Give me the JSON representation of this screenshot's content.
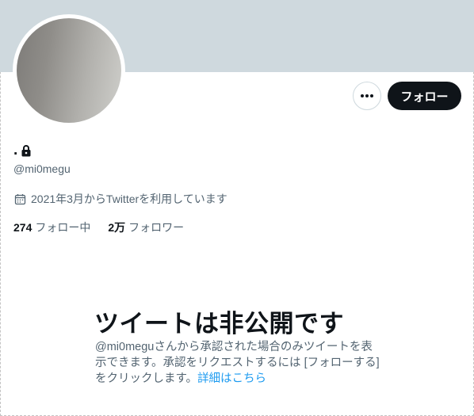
{
  "profile": {
    "display_name": ".",
    "handle": "@mi0megu",
    "joined": "2021年3月からTwitterを利用しています",
    "following_count": "274",
    "following_label": "フォロー中",
    "followers_count": "2万",
    "followers_label": "フォロワー"
  },
  "actions": {
    "follow_label": "フォロー",
    "more_icon": "ellipsis-icon"
  },
  "private_notice": {
    "title": "ツイートは非公開です",
    "description": "@mi0meguさんから承認された場合のみツイートを表示できます。承認をリクエストするには [フォローする] をクリックします。",
    "learn_more": "詳細はこちら"
  },
  "colors": {
    "banner": "#cfd9de",
    "primary_text": "#0f1419",
    "secondary_text": "#536471",
    "link": "#1d9bf0"
  }
}
